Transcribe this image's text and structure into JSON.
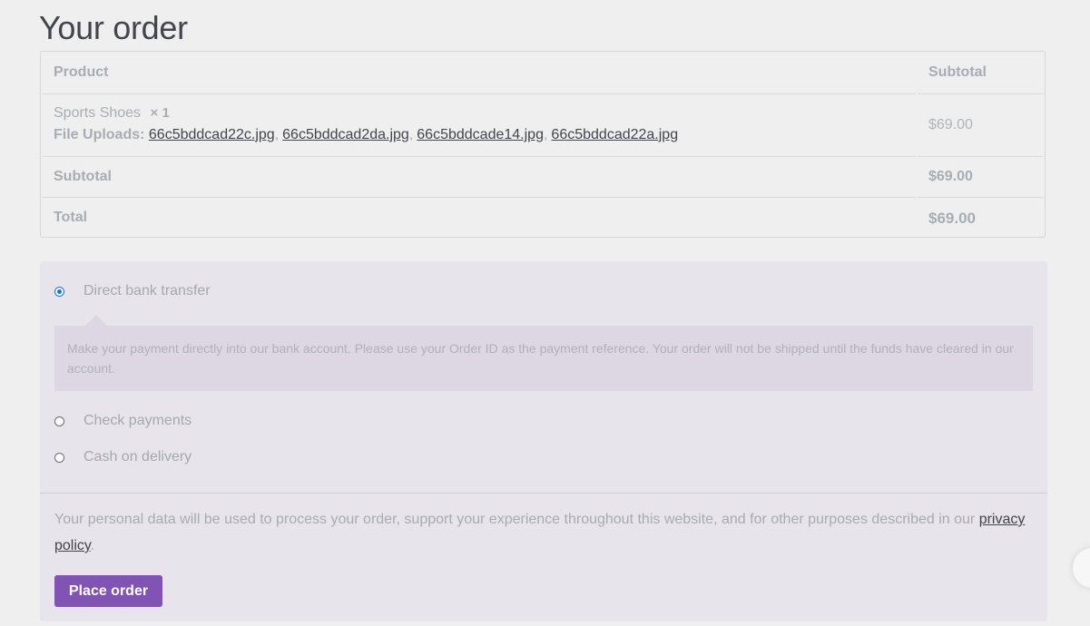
{
  "page": {
    "title": "Your order"
  },
  "order_table": {
    "headers": {
      "product": "Product",
      "subtotal": "Subtotal"
    },
    "item": {
      "name": "Sports Shoes",
      "quantity": "× 1",
      "uploads_label": "File Uploads:",
      "files": [
        "66c5bddcad22c.jpg",
        "66c5bddcad2da.jpg",
        "66c5bddcade14.jpg",
        "66c5bddcad22a.jpg"
      ],
      "price": "$69.00"
    },
    "subtotal": {
      "label": "Subtotal",
      "value": "$69.00"
    },
    "total": {
      "label": "Total",
      "value": "$69.00"
    }
  },
  "payment": {
    "methods": [
      {
        "label": "Direct bank transfer",
        "selected": true
      },
      {
        "label": "Check payments",
        "selected": false
      },
      {
        "label": "Cash on delivery",
        "selected": false
      }
    ],
    "description": "Make your payment directly into our bank account. Please use your Order ID as the payment reference. Your order will not be shipped until the funds have cleared in our account."
  },
  "privacy": {
    "text": "Your personal data will be used to process your order, support your experience throughout this website, and for other purposes described in our",
    "link": "privacy policy",
    "suffix": "."
  },
  "actions": {
    "place_order": "Place order"
  },
  "colors": {
    "accent": "#7f54b3",
    "radio_selected": "#1a73e8",
    "payment_bg": "#e7e4ec"
  }
}
